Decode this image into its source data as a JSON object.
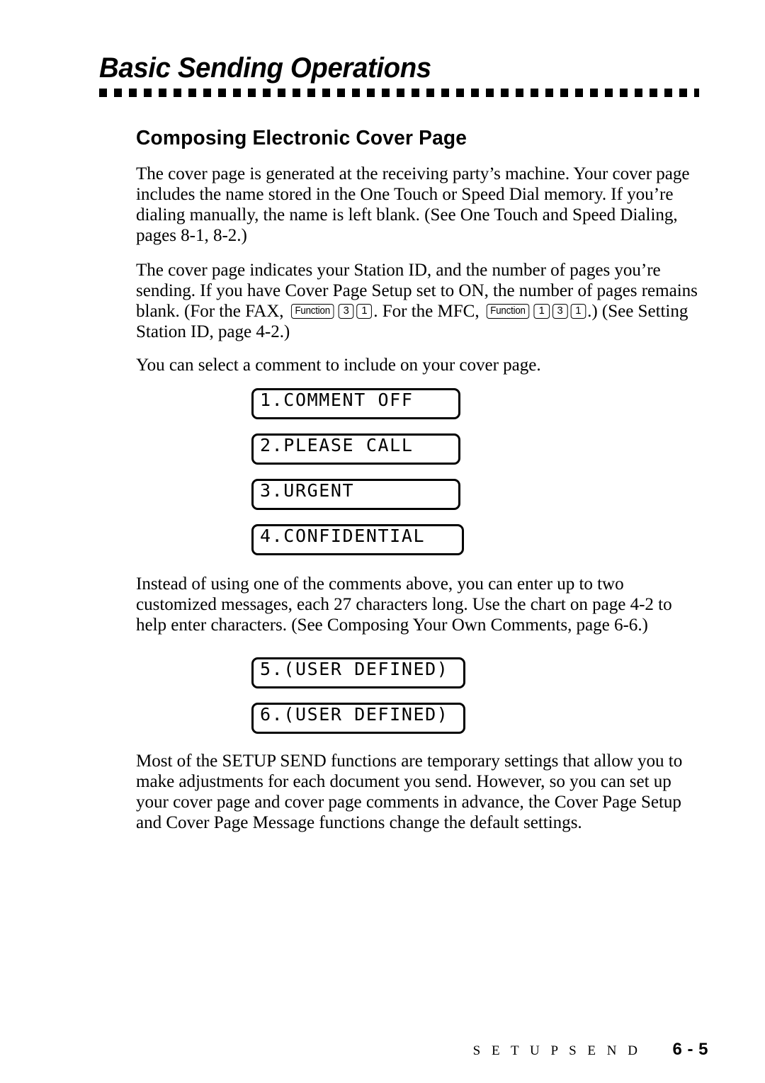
{
  "header": {
    "chapter_title": "Basic Sending Operations",
    "rule_style": "square-dot-rule"
  },
  "section": {
    "heading": "Composing Electronic Cover Page"
  },
  "paragraphs": {
    "p1": "The cover page is generated at the receiving party’s machine. Your cover page includes the name stored in the One Touch or Speed Dial memory. If you’re dialing manually, the name is left blank. (See One Touch and Speed Dialing, pages 8-1, 8-2.)",
    "p2_part1": "The cover page indicates your Station ID, and the number of pages you’re sending. If you have Cover Page Setup set to ON, the number of pages remains blank. (For the FAX, ",
    "p2_part2": ". For the MFC, ",
    "p2_part3": ".) (See Setting Station ID, page 4-2.)",
    "p3": "You can select a comment to include on your cover page.",
    "p4": "Instead of using one of the comments above, you can enter up to two customized messages, each 27 characters long. Use the chart on page 4-2 to help enter characters. (See Composing Your Own Comments, page 6-6.)",
    "p5": "Most of the SETUP SEND functions are temporary settings that allow you to make adjustments for each document you send. However, so you can set up your cover page and cover page comments in advance, the Cover Page Setup and Cover Page Message functions change the default settings."
  },
  "keys": {
    "fax_sequence": [
      {
        "label": "Function",
        "type": "function"
      },
      {
        "label": "3",
        "type": "number"
      },
      {
        "label": "1",
        "type": "number"
      }
    ],
    "mfc_sequence": [
      {
        "label": "Function",
        "type": "function"
      },
      {
        "label": "1",
        "type": "number"
      },
      {
        "label": "3",
        "type": "number"
      },
      {
        "label": "1",
        "type": "number"
      }
    ]
  },
  "lcd_group_1": [
    {
      "text": "1.COMMENT OFF"
    },
    {
      "text": "2.PLEASE CALL"
    },
    {
      "text": "3.URGENT"
    },
    {
      "text": "4.CONFIDENTIAL"
    }
  ],
  "lcd_group_2": [
    {
      "text": "5.(USER DEFINED)"
    },
    {
      "text": "6.(USER DEFINED)"
    }
  ],
  "footer": {
    "label": "S E T U P   S E N D",
    "page_number": "6 - 5"
  },
  "colors": {
    "ink": "#000000",
    "paper": "#ffffff"
  }
}
